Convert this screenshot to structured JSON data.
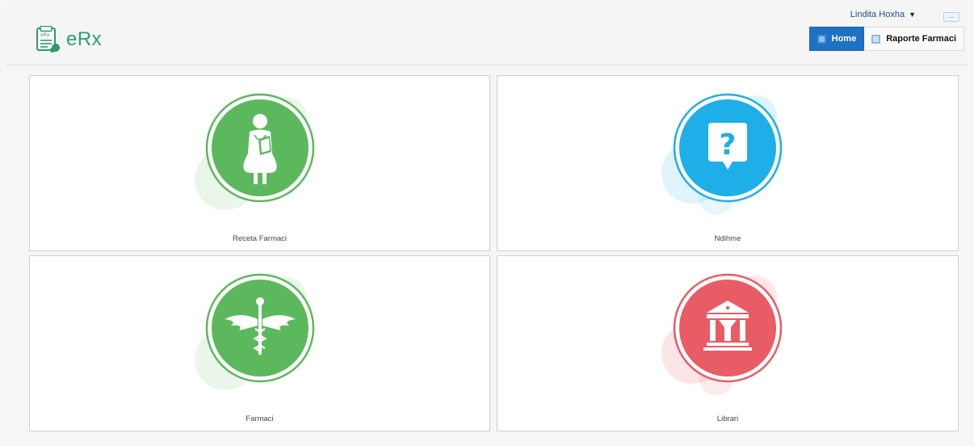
{
  "app": {
    "name": "eRx"
  },
  "header": {
    "user_name": "Lindita Hoxha",
    "user_caret": "▼",
    "more_label": "...",
    "tabs": [
      {
        "label": "Home",
        "active": true
      },
      {
        "label": "Raporte Farmaci",
        "active": false
      }
    ]
  },
  "tiles": [
    {
      "label": "Receta Farmaci",
      "icon": "pharmacist-icon",
      "color": "#5cb85c"
    },
    {
      "label": "Ndihme",
      "icon": "help-question-icon",
      "color": "#1eaee8"
    },
    {
      "label": "Farmaci",
      "icon": "caduceus-icon",
      "color": "#5cb85c"
    },
    {
      "label": "Librari",
      "icon": "library-building-icon",
      "color": "#e85c66"
    }
  ]
}
